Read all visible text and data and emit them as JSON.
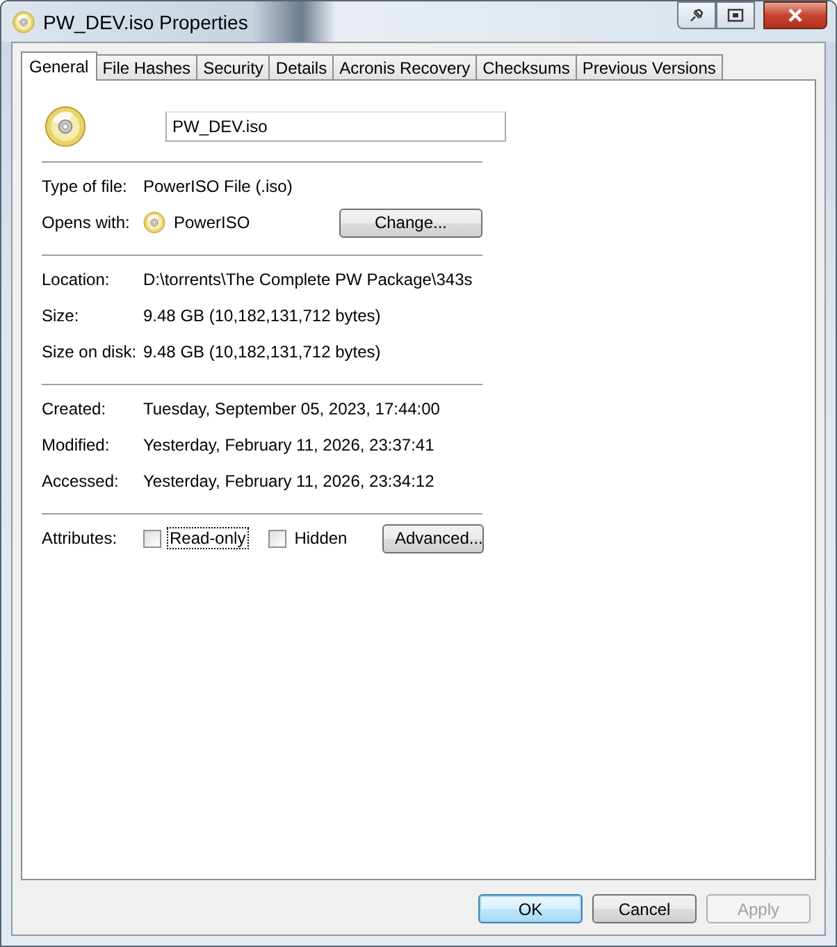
{
  "window": {
    "title": "PW_DEV.iso Properties"
  },
  "tabs": [
    {
      "label": "General",
      "selected": true
    },
    {
      "label": "File Hashes",
      "selected": false
    },
    {
      "label": "Security",
      "selected": false
    },
    {
      "label": "Details",
      "selected": false
    },
    {
      "label": "Acronis Recovery",
      "selected": false
    },
    {
      "label": "Checksums",
      "selected": false
    },
    {
      "label": "Previous Versions",
      "selected": false
    }
  ],
  "file": {
    "name": "PW_DEV.iso"
  },
  "sections": [
    [
      {
        "kind": "text",
        "label": "Type of file:",
        "value": "PowerISO File (.iso)"
      },
      {
        "kind": "app",
        "label": "Opens with:",
        "value": "PowerISO",
        "button": "Change..."
      }
    ],
    [
      {
        "kind": "text",
        "label": "Location:",
        "value": "D:\\torrents\\The Complete PW Package\\343s"
      },
      {
        "kind": "text",
        "label": "Size:",
        "value": "9.48 GB (10,182,131,712 bytes)"
      },
      {
        "kind": "text",
        "label": "Size on disk:",
        "value": "9.48 GB (10,182,131,712 bytes)"
      }
    ],
    [
      {
        "kind": "text",
        "label": "Created:",
        "value": "Tuesday, September 05, 2023, 17:44:00"
      },
      {
        "kind": "text",
        "label": "Modified:",
        "value": "Yesterday, February 11, 2026, 23:37:41"
      },
      {
        "kind": "text",
        "label": "Accessed:",
        "value": "Yesterday, February 11, 2026, 23:34:12"
      }
    ]
  ],
  "attributes": {
    "label": "Attributes:",
    "options": [
      {
        "label": "Read-only",
        "checked": false,
        "focused": true
      },
      {
        "label": "Hidden",
        "checked": false,
        "focused": false
      }
    ],
    "button": "Advanced..."
  },
  "buttons": [
    {
      "label": "OK",
      "default": true,
      "disabled": false
    },
    {
      "label": "Cancel",
      "default": false,
      "disabled": false
    },
    {
      "label": "Apply",
      "default": false,
      "disabled": true
    }
  ]
}
